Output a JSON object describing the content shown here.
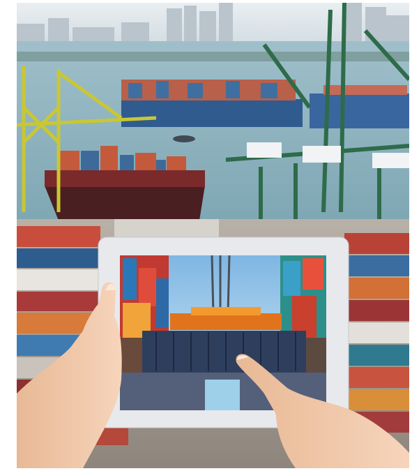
{
  "photo": {
    "subject": "port-scene",
    "colors": {
      "sky": "#d9e2e8",
      "water": "#8fb3c0",
      "ship_hull_blue": "#2f5b8f",
      "ship_hull_red": "#7a2a2a",
      "crane_yellow": "#c9c733",
      "crane_green": "#2e6b4a",
      "tablet_frame": "#e8e9ec",
      "tablet_sky": "#8cc0e6",
      "container_dark": "#2e3f5e",
      "spreader_orange": "#e0731c",
      "skin": "#f0c6a8"
    }
  }
}
